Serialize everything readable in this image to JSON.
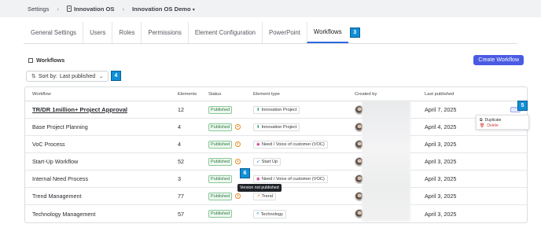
{
  "breadcrumb": {
    "settings": "Settings",
    "os": "Innovation OS",
    "demo": "Innovation OS Demo"
  },
  "tabs": [
    {
      "label": "General Settings"
    },
    {
      "label": "Users"
    },
    {
      "label": "Roles"
    },
    {
      "label": "Permissions"
    },
    {
      "label": "Element Configuration"
    },
    {
      "label": "PowerPoint"
    },
    {
      "label": "Workflows",
      "active": true
    }
  ],
  "annotations": {
    "tabs": "3",
    "sort": "4",
    "menu": "5",
    "status": "6"
  },
  "section": {
    "title": "Workflows",
    "create_label": "Create Workflow"
  },
  "sort": {
    "prefix": "Sort by:",
    "value": "Last published"
  },
  "table": {
    "headers": {
      "workflow": "Workflow",
      "elements": "Elements",
      "status": "Status",
      "element_type": "Element type",
      "created_by": "Created by",
      "last_published": "Last published"
    },
    "rows": [
      {
        "name": "TR/DR 1million+ Project Approval",
        "elements": "12",
        "status": "Published",
        "type": "Innovation Project",
        "type_icon": "innovation-icon",
        "date": "April 7, 2025"
      },
      {
        "name": "Base Project Planning",
        "elements": "4",
        "status": "Published",
        "type": "Innovation Project",
        "type_icon": "innovation-icon",
        "date": "April 4, 2025"
      },
      {
        "name": "VoC Process",
        "elements": "4",
        "status": "Published",
        "type": "Need / Voice of customer (VOC)",
        "type_icon": "need-icon",
        "date": "April 3, 2025"
      },
      {
        "name": "Start-Up Workflow",
        "elements": "52",
        "status": "Published",
        "type": "Start Up",
        "type_icon": "startup-icon",
        "date": "April 3, 2025"
      },
      {
        "name": "Internal Need Process",
        "elements": "3",
        "status": "Published",
        "type": "Need / Voice of customer (VOC)",
        "type_icon": "need-icon",
        "date": "April 3, 2025"
      },
      {
        "name": "Trend Management",
        "elements": "77",
        "status": "Published",
        "type": "Trend",
        "type_icon": "trend-icon",
        "date": "April 3, 2025"
      },
      {
        "name": "Technology Management",
        "elements": "57",
        "status": "Published",
        "type": "Technology",
        "type_icon": "technology-icon",
        "date": "April 3, 2025"
      }
    ]
  },
  "row_menu": {
    "button": "···",
    "duplicate": "Duplicate",
    "delete": "Delete"
  },
  "tooltip": "Version not published",
  "colors": {
    "accent": "#4a5be3",
    "annotation": "#0f8fd6",
    "published": "#2d7a40",
    "pending": "#e68a1e",
    "danger": "#d23c3c"
  }
}
